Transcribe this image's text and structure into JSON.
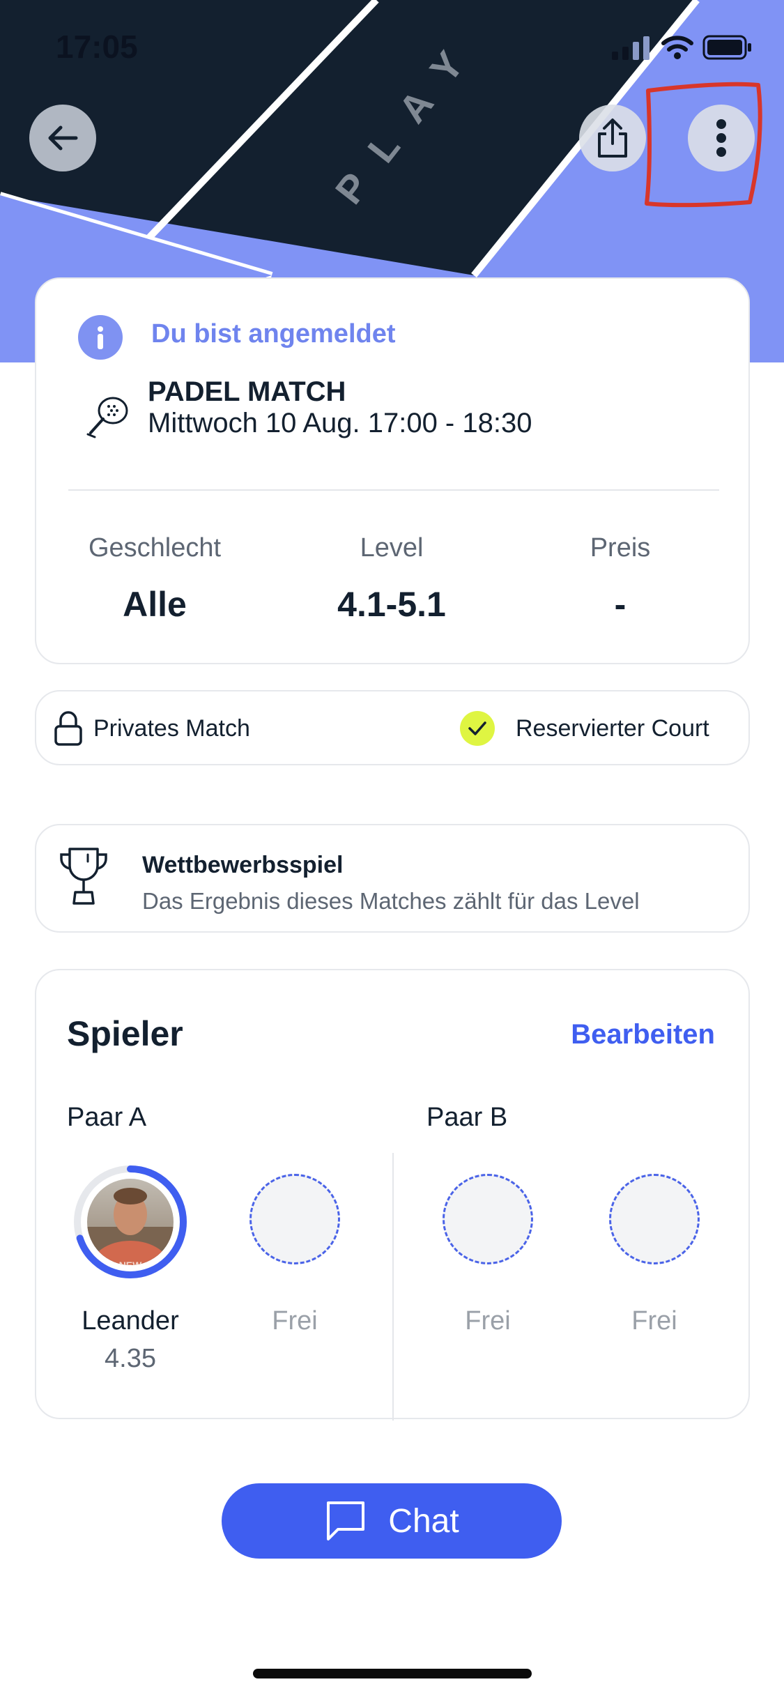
{
  "status_bar": {
    "time": "17:05"
  },
  "hero": {
    "court_text": "PLAY"
  },
  "info_card": {
    "registered_text": "Du bist angemeldet",
    "match_title": "PADEL MATCH",
    "match_datetime": "Mittwoch 10 Aug. 17:00 - 18:30",
    "stats": [
      {
        "label": "Geschlecht",
        "value": "Alle"
      },
      {
        "label": "Level",
        "value": "4.1-5.1"
      },
      {
        "label": "Preis",
        "value": "-"
      }
    ]
  },
  "flags": {
    "private_label": "Privates Match",
    "reserved_label": "Reservierter Court"
  },
  "competition": {
    "title": "Wettbewerbsspiel",
    "description": "Das Ergebnis dieses Matches zählt für das Level"
  },
  "players": {
    "title": "Spieler",
    "edit_label": "Bearbeiten",
    "pair_a_label": "Paar A",
    "pair_b_label": "Paar B",
    "player1": {
      "name": "Leander",
      "level": "4.35",
      "level_progress": 0.7
    },
    "free_label": "Frei"
  },
  "chat_button": {
    "label": "Chat"
  },
  "colors": {
    "accent": "#3f5ef0",
    "hero_dark": "#13202f",
    "hero_light": "#8093f5",
    "check_yellow": "#dff542",
    "annotation_red": "#d8362a"
  }
}
